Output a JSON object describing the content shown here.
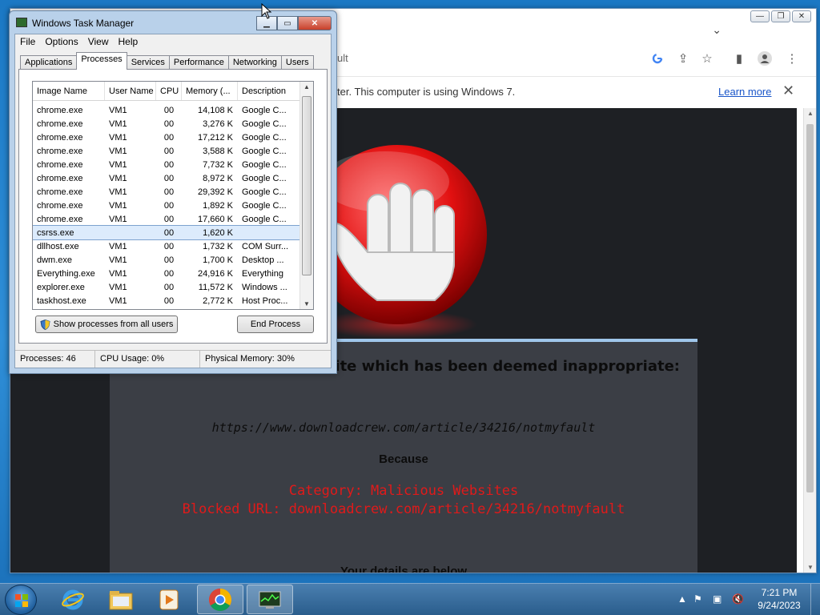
{
  "chrome": {
    "omnibox_partial": "ult",
    "infobar_text": "ter. This computer is using Windows 7.",
    "infobar_link": "Learn more"
  },
  "blockpage": {
    "heading": "a website which has been deemed inappropriate:",
    "url": "https://www.downloadcrew.com/article/34216/notmyfault",
    "because": "Because",
    "category": "Category: Malicious Websites",
    "blocked_url": "Blocked URL: downloadcrew.com/article/34216/notmyfault",
    "details": "Your details are below"
  },
  "taskmgr": {
    "title": "Windows Task Manager",
    "menu": [
      "File",
      "Options",
      "View",
      "Help"
    ],
    "tabs": [
      "Applications",
      "Processes",
      "Services",
      "Performance",
      "Networking",
      "Users"
    ],
    "active_tab": "Processes",
    "columns": [
      "Image Name",
      "User Name",
      "CPU",
      "Memory (...",
      "Description"
    ],
    "rows": [
      {
        "name": "chrome.exe",
        "user": "VM1",
        "cpu": "00",
        "mem": "14,108 K",
        "desc": "Google C..."
      },
      {
        "name": "chrome.exe",
        "user": "VM1",
        "cpu": "00",
        "mem": "3,276 K",
        "desc": "Google C..."
      },
      {
        "name": "chrome.exe",
        "user": "VM1",
        "cpu": "00",
        "mem": "17,212 K",
        "desc": "Google C..."
      },
      {
        "name": "chrome.exe",
        "user": "VM1",
        "cpu": "00",
        "mem": "3,588 K",
        "desc": "Google C..."
      },
      {
        "name": "chrome.exe",
        "user": "VM1",
        "cpu": "00",
        "mem": "7,732 K",
        "desc": "Google C..."
      },
      {
        "name": "chrome.exe",
        "user": "VM1",
        "cpu": "00",
        "mem": "8,972 K",
        "desc": "Google C..."
      },
      {
        "name": "chrome.exe",
        "user": "VM1",
        "cpu": "00",
        "mem": "29,392 K",
        "desc": "Google C..."
      },
      {
        "name": "chrome.exe",
        "user": "VM1",
        "cpu": "00",
        "mem": "1,892 K",
        "desc": "Google C..."
      },
      {
        "name": "chrome.exe",
        "user": "VM1",
        "cpu": "00",
        "mem": "17,660 K",
        "desc": "Google C..."
      },
      {
        "name": "csrss.exe",
        "user": "",
        "cpu": "00",
        "mem": "1,620 K",
        "desc": "",
        "selected": true
      },
      {
        "name": "dllhost.exe",
        "user": "VM1",
        "cpu": "00",
        "mem": "1,732 K",
        "desc": "COM Surr..."
      },
      {
        "name": "dwm.exe",
        "user": "VM1",
        "cpu": "00",
        "mem": "1,700 K",
        "desc": "Desktop ..."
      },
      {
        "name": "Everything.exe",
        "user": "VM1",
        "cpu": "00",
        "mem": "24,916 K",
        "desc": "Everything"
      },
      {
        "name": "explorer.exe",
        "user": "VM1",
        "cpu": "00",
        "mem": "11,572 K",
        "desc": "Windows ..."
      },
      {
        "name": "taskhost.exe",
        "user": "VM1",
        "cpu": "00",
        "mem": "2,772 K",
        "desc": "Host Proc..."
      }
    ],
    "show_all_button": "Show processes from all users",
    "end_process_button": "End Process",
    "status": {
      "processes": "Processes: 46",
      "cpu": "CPU Usage: 0%",
      "memory": "Physical Memory: 30%"
    }
  },
  "taskbar": {
    "time": "7:21 PM",
    "date": "9/24/2023"
  },
  "colors": {
    "accent": "#1a56c9",
    "warning_red": "#e01a1a",
    "blockpage_bg": "#1e2024",
    "panel_bg": "#3b3e45"
  }
}
